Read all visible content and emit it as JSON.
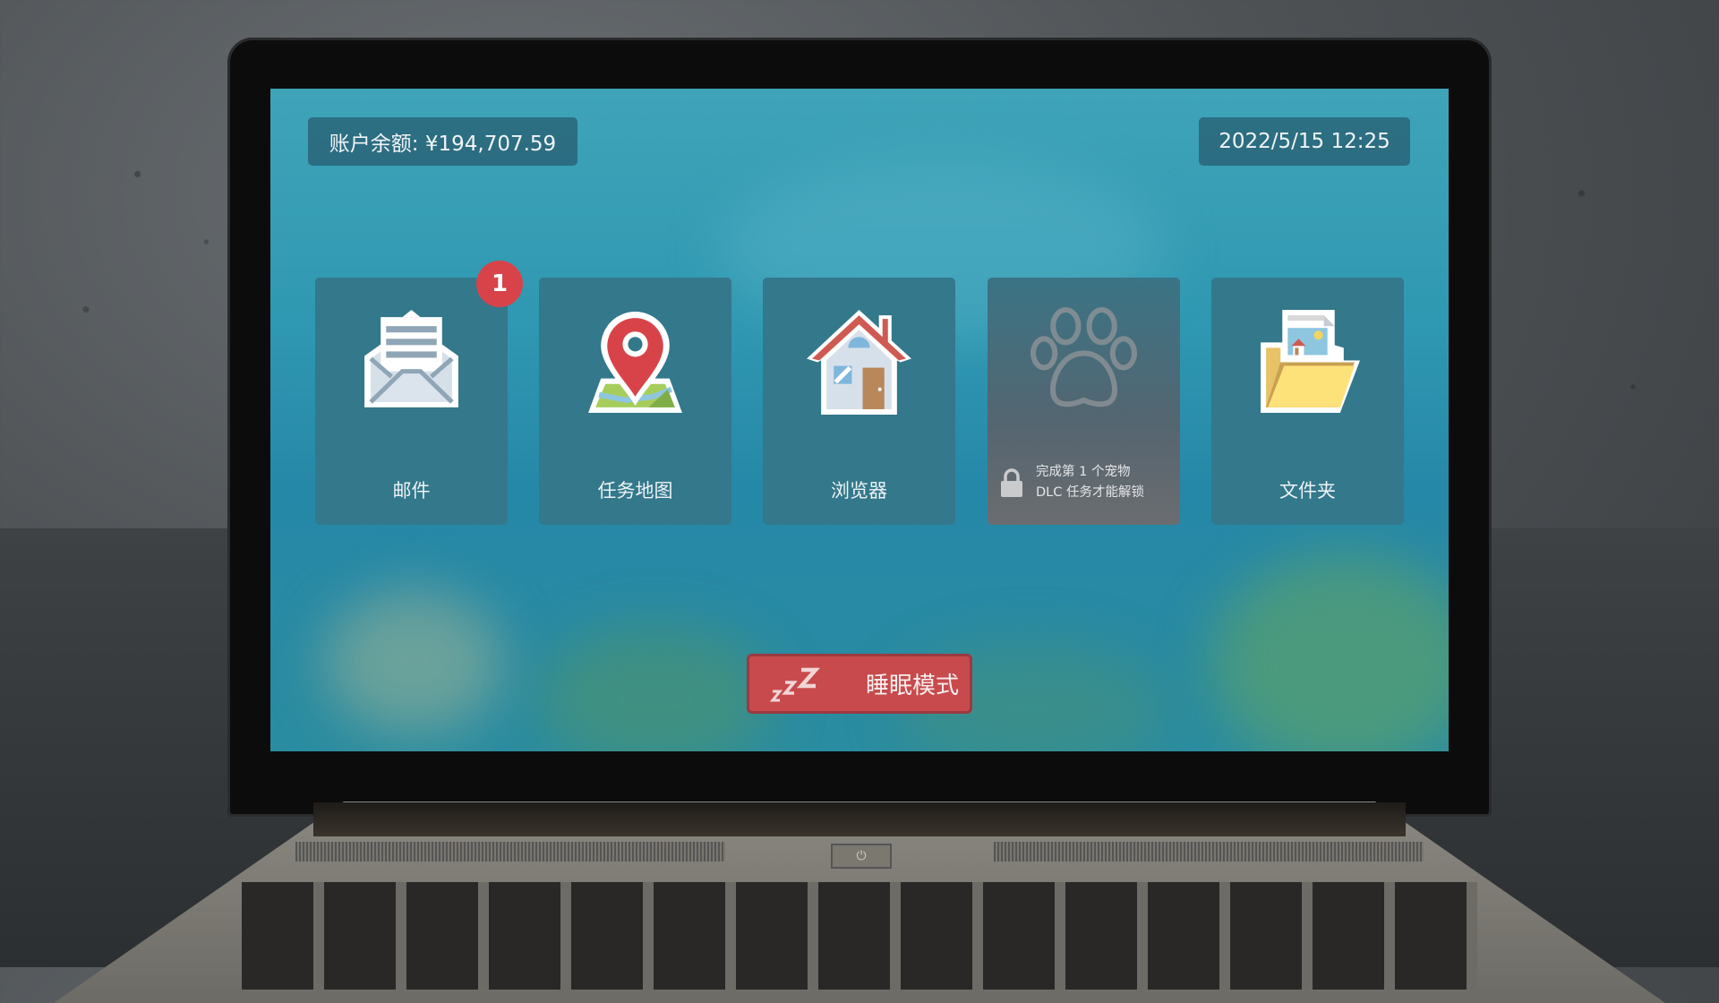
{
  "header": {
    "balance_label": "账户余额: ¥194,707.59",
    "datetime": "2022/5/15 12:25"
  },
  "apps": [
    {
      "id": "mail",
      "label": "邮件",
      "icon": "envelope-icon",
      "badge": "1"
    },
    {
      "id": "mission-map",
      "label": "任务地图",
      "icon": "map-pin-icon"
    },
    {
      "id": "browser",
      "label": "浏览器",
      "icon": "house-icon"
    },
    {
      "id": "pet",
      "label": "",
      "icon": "paw-icon",
      "locked": true,
      "lock_text_line1": "完成第 1 个宠物",
      "lock_text_line2": "DLC 任务才能解锁"
    },
    {
      "id": "folder",
      "label": "文件夹",
      "icon": "folder-icon"
    }
  ],
  "sleep_button": {
    "label": "睡眠模式",
    "icon": "zzz-icon"
  },
  "keyboard": {
    "power_icon": "⏻"
  },
  "colors": {
    "accent_red": "#c84a4c",
    "badge_red": "#d8434a",
    "tile": "#33788b",
    "screen": "#2f98b2"
  }
}
